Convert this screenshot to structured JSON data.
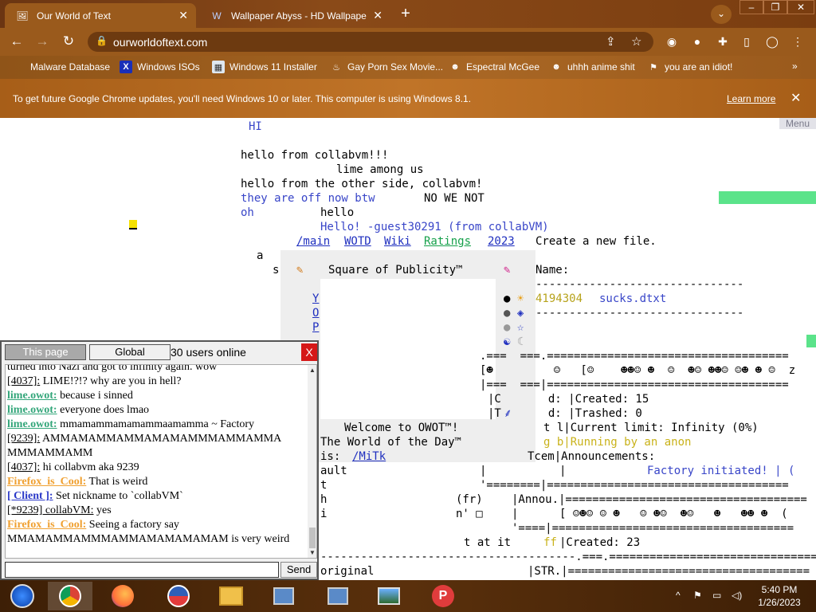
{
  "browser": {
    "tabs": [
      {
        "title": "Our World of Text",
        "icon": "owot-favicon-icon"
      },
      {
        "title": "Wallpaper Abyss - HD Wallpaper",
        "icon": "wallpaper-abyss-favicon-icon"
      }
    ],
    "url": "ourworldoftext.com",
    "bookmarks": [
      {
        "label": "Malware Database"
      },
      {
        "label": "Windows ISOs"
      },
      {
        "label": "Windows 11 Installer"
      },
      {
        "label": "Gay Porn Sex Movie..."
      },
      {
        "label": "Espectral McGee"
      },
      {
        "label": "uhhh anime shit"
      },
      {
        "label": "you are an idiot!"
      }
    ],
    "infobar": {
      "message": "To get future Google Chrome updates, you'll need Windows 10 or later. This computer is using Windows 8.1.",
      "link": "Learn more"
    }
  },
  "page": {
    "menu_label": "Menu",
    "lines": {
      "hi": "HI",
      "l1": "hello from collabvm!!!",
      "l2": "lime among us",
      "l3": "hello from the other side, collabvm!",
      "l4a": "they are off now btw",
      "l4b": "NO WE NOT",
      "l5a": "oh",
      "l5b": "hello",
      "l6": "Hello! -guest30291 (from collabVM)",
      "nav_main": "/main",
      "nav_wotd": "WOTD",
      "nav_wiki": "Wiki",
      "nav_ratings": "Ratings",
      "nav_2023": "2023",
      "create": "Create a new file.",
      "a": "a",
      "s": "s",
      "square": "Square of Publicity™",
      "name": "Name:",
      "dashes1": "-------------------------------",
      "file_num": "4194304",
      "file_name": "sucks.dtxt",
      "dashes2": "-------------------------------",
      "col_y": "Y",
      "col_o": "O",
      "col_p": "P",
      "border1": ".===  ===.====================================",
      "faces1": "[☻         ☺   [☺    ☻☻☺ ☻  ☺  ☻☺ ☻☻☺ ☺☻ ☻ ☺  z",
      "border2": "|===  ===|====================================",
      "created15a": "|C       d: |Created: 15",
      "trashed": "|T       d: |Trashed: 0",
      "limit": "t l|Current limit: Infinity (0%)",
      "running": "g b|Running by an anon",
      "announce": "Tcem|Announcements:",
      "factory": "Factory initiated! | (",
      "welcome": "Welcome to OWOT™!",
      "wotd": "The World of the Day™",
      "is": "is:",
      "mitk": "/MiTk",
      "ault": "ault",
      "t1": "t",
      "h1": "h",
      "i1": "i",
      "fr": "(fr)",
      "nq": "n' □",
      "border3": "'========|====================================",
      "annou": "|Annou.|====================================",
      "faces2": "[ ☺☻☺ ☺ ☻   ☺ ☻☺  ☻☺   ☻   ☻☻ ☻  (",
      "border4": "'====|====================================",
      "tatit": "t at it",
      "ff": "ff",
      "created23": "|Created: 23",
      "dashes3": "--------------------------------------.===.====================================",
      "original": "original",
      "str": "|STR.|===================================="
    }
  },
  "chat": {
    "tab_page": "This page",
    "tab_global": "Global",
    "online": "30 users online",
    "close": "X",
    "send": "Send",
    "messages": [
      {
        "nick": "",
        "text": "turned into Nazi and got to infinity again. wow",
        "kind": "plain"
      },
      {
        "nick": "[4037]:",
        "text": " LIME!?!? why are you in hell?",
        "kind": "num"
      },
      {
        "nick": "lime.owot:",
        "text": " because i sinned",
        "kind": "lime"
      },
      {
        "nick": "lime.owot:",
        "text": " everyone does lmao",
        "kind": "lime"
      },
      {
        "nick": "lime.owot:",
        "text": " mmamammamamammaamamma ~ Factory",
        "kind": "lime"
      },
      {
        "nick": "[9239]:",
        "text": " AMMAMAMMAMMAMAMAMMMAMMAMMA MMMAMMAMM",
        "kind": "num"
      },
      {
        "nick": "[4037]:",
        "text": " hi collabvm aka 9239",
        "kind": "num"
      },
      {
        "nick": "Firefox_is_Cool:",
        "text": " That is weird",
        "kind": "ff"
      },
      {
        "nick": "[ Client ]:",
        "text": " Set nickname to `collabVM`",
        "kind": "client"
      },
      {
        "nick": "[*9239] collabVM:",
        "text": " yes",
        "kind": "num"
      },
      {
        "nick": "Firefox_is_Cool:",
        "text": " Seeing a factory say MMAMAMMAMMMAMMAMAMAMAMAM is very weird",
        "kind": "ff"
      }
    ]
  },
  "taskbar": {
    "time": "5:40 PM",
    "date": "1/26/2023"
  },
  "colors": {
    "accent_green": "#5be38a",
    "chat_close": "#d51818",
    "link_blue": "#1f2fbf"
  }
}
